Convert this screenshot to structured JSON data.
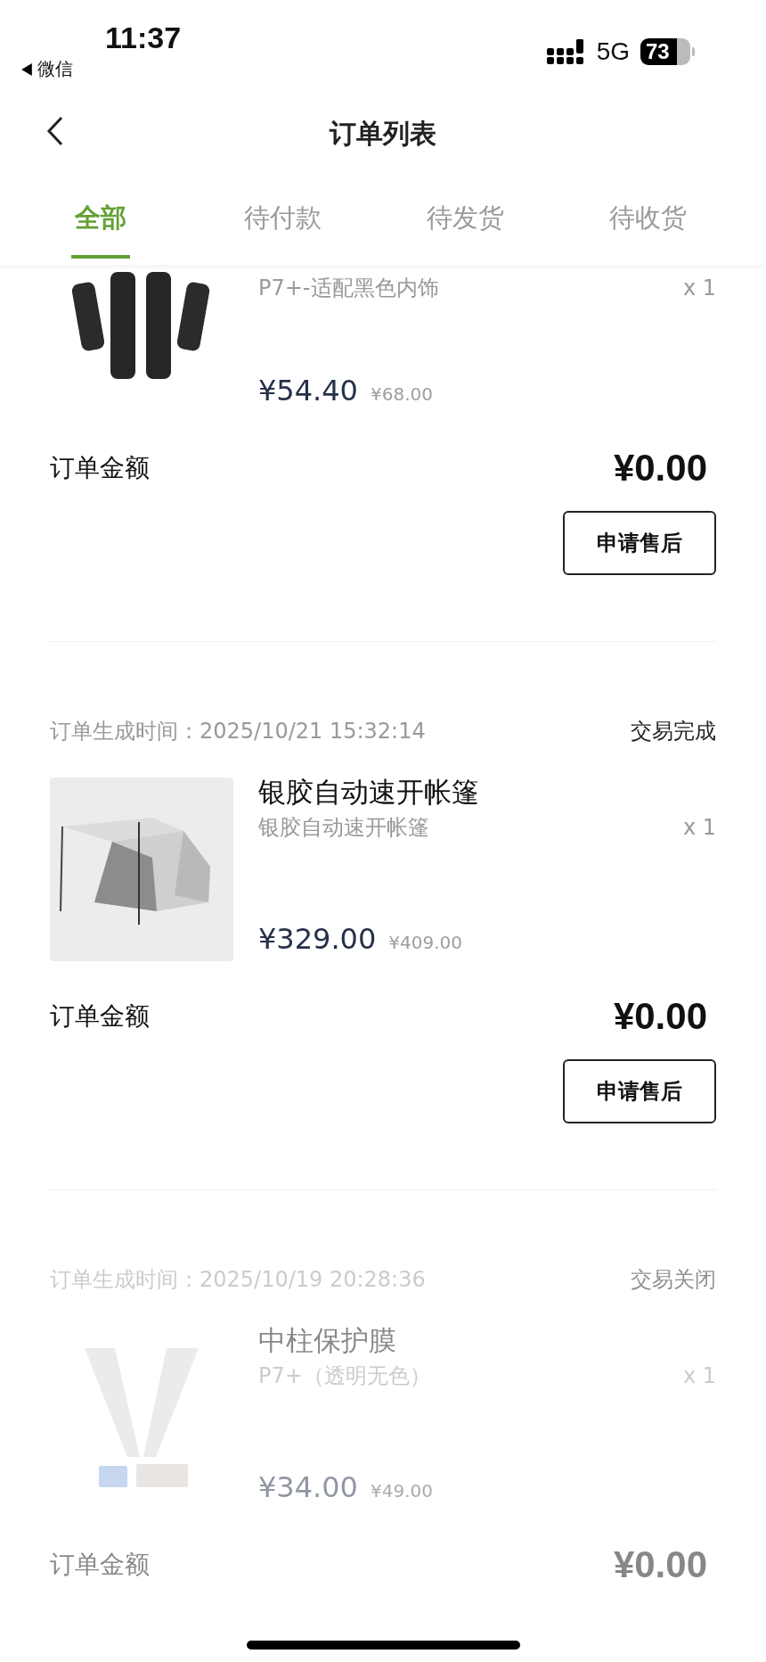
{
  "status_bar": {
    "time": "11:37",
    "back_app": "微信",
    "network": "5G",
    "battery": "73"
  },
  "nav": {
    "title": "订单列表"
  },
  "tabs": [
    {
      "label": "全部",
      "selected": true
    },
    {
      "label": "待付款",
      "selected": false
    },
    {
      "label": "待发货",
      "selected": false
    },
    {
      "label": "待收货",
      "selected": false
    }
  ],
  "orders": [
    {
      "kind": "seat-pads",
      "faded": false,
      "variant": "P7+-适配黑色内饰",
      "quantity": "x 1",
      "price": "¥54.40",
      "original_price": "¥68.00",
      "amount_label": "订单金额",
      "amount": "¥0.00",
      "button": "申请售后"
    },
    {
      "kind": "tent",
      "faded": false,
      "date": "订单生成时间：2025/10/21 15:32:14",
      "status": "交易完成",
      "title": "银胶自动速开帐篷",
      "variant": "银胶自动速开帐篷",
      "quantity": "x 1",
      "price": "¥329.00",
      "original_price": "¥409.00",
      "amount_label": "订单金额",
      "amount": "¥0.00",
      "button": "申请售后"
    },
    {
      "kind": "film",
      "faded": true,
      "date": "订单生成时间：2025/10/19 20:28:36",
      "status": "交易关闭",
      "title": "中柱保护膜",
      "variant": "P7+（透明无色）",
      "quantity": "x 1",
      "price": "¥34.00",
      "original_price": "¥49.00",
      "amount_label": "订单金额",
      "amount": "¥0.00"
    }
  ]
}
